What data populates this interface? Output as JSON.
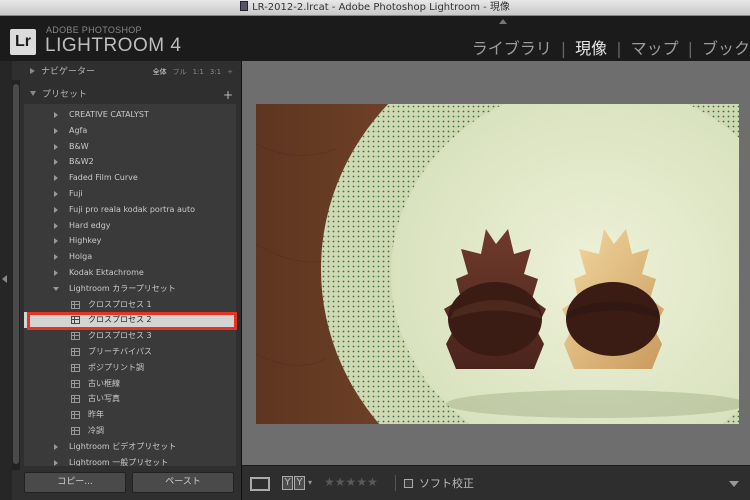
{
  "window": {
    "title": "LR-2012-2.lrcat - Adobe Photoshop Lightroom - 現像"
  },
  "brand": {
    "logo": "Lr",
    "subtitle": "ADOBE PHOTOSHOP",
    "product": "LIGHTROOM 4"
  },
  "modules": {
    "library": "ライブラリ",
    "develop": "現像",
    "map": "マップ",
    "book": "ブック",
    "separator": "|",
    "active": "develop"
  },
  "navigator": {
    "label": "ナビゲーター",
    "zoom_options": [
      "全体",
      "フル",
      "1:1",
      "3:1"
    ],
    "zoom_selected": "全体",
    "zoom_menu": "÷"
  },
  "presets": {
    "label": "プリセット",
    "add_label": "+",
    "folders_top": [
      "CREATIVE CATALYST",
      "Agfa",
      "B&W",
      "B&W2",
      "Faded Film Curve",
      "Fuji",
      "Fuji pro reala kodak portra auto",
      "Hard edgy",
      "Highkey",
      "Holga",
      "Kodak Ektachrome"
    ],
    "open_folder": "Lightroom カラープリセット",
    "items": [
      "クロスプロセス 1",
      "クロスプロセス 2",
      "クロスプロセス 3",
      "ブリーチバイパス",
      "ポジプリント調",
      "古い框線",
      "古い写真",
      "昨年",
      "冷調"
    ],
    "selected_item": "クロスプロセス 2",
    "folders_bottom": [
      "Lightroom ビデオプリセット",
      "Lightroom 一般プリセット"
    ]
  },
  "buttons": {
    "copy": "コピー...",
    "paste": "ペースト"
  },
  "toolbar": {
    "view_mode": "loupe",
    "before_after": [
      "Y",
      "Y"
    ],
    "stars": "★★★★★",
    "rating": 0,
    "soft_proof_label": "ソフト校正",
    "soft_proof_checked": false
  },
  "colors": {
    "highlight": "#e83222",
    "panel": "#2f2f2f",
    "background": "#6e6e6e"
  }
}
